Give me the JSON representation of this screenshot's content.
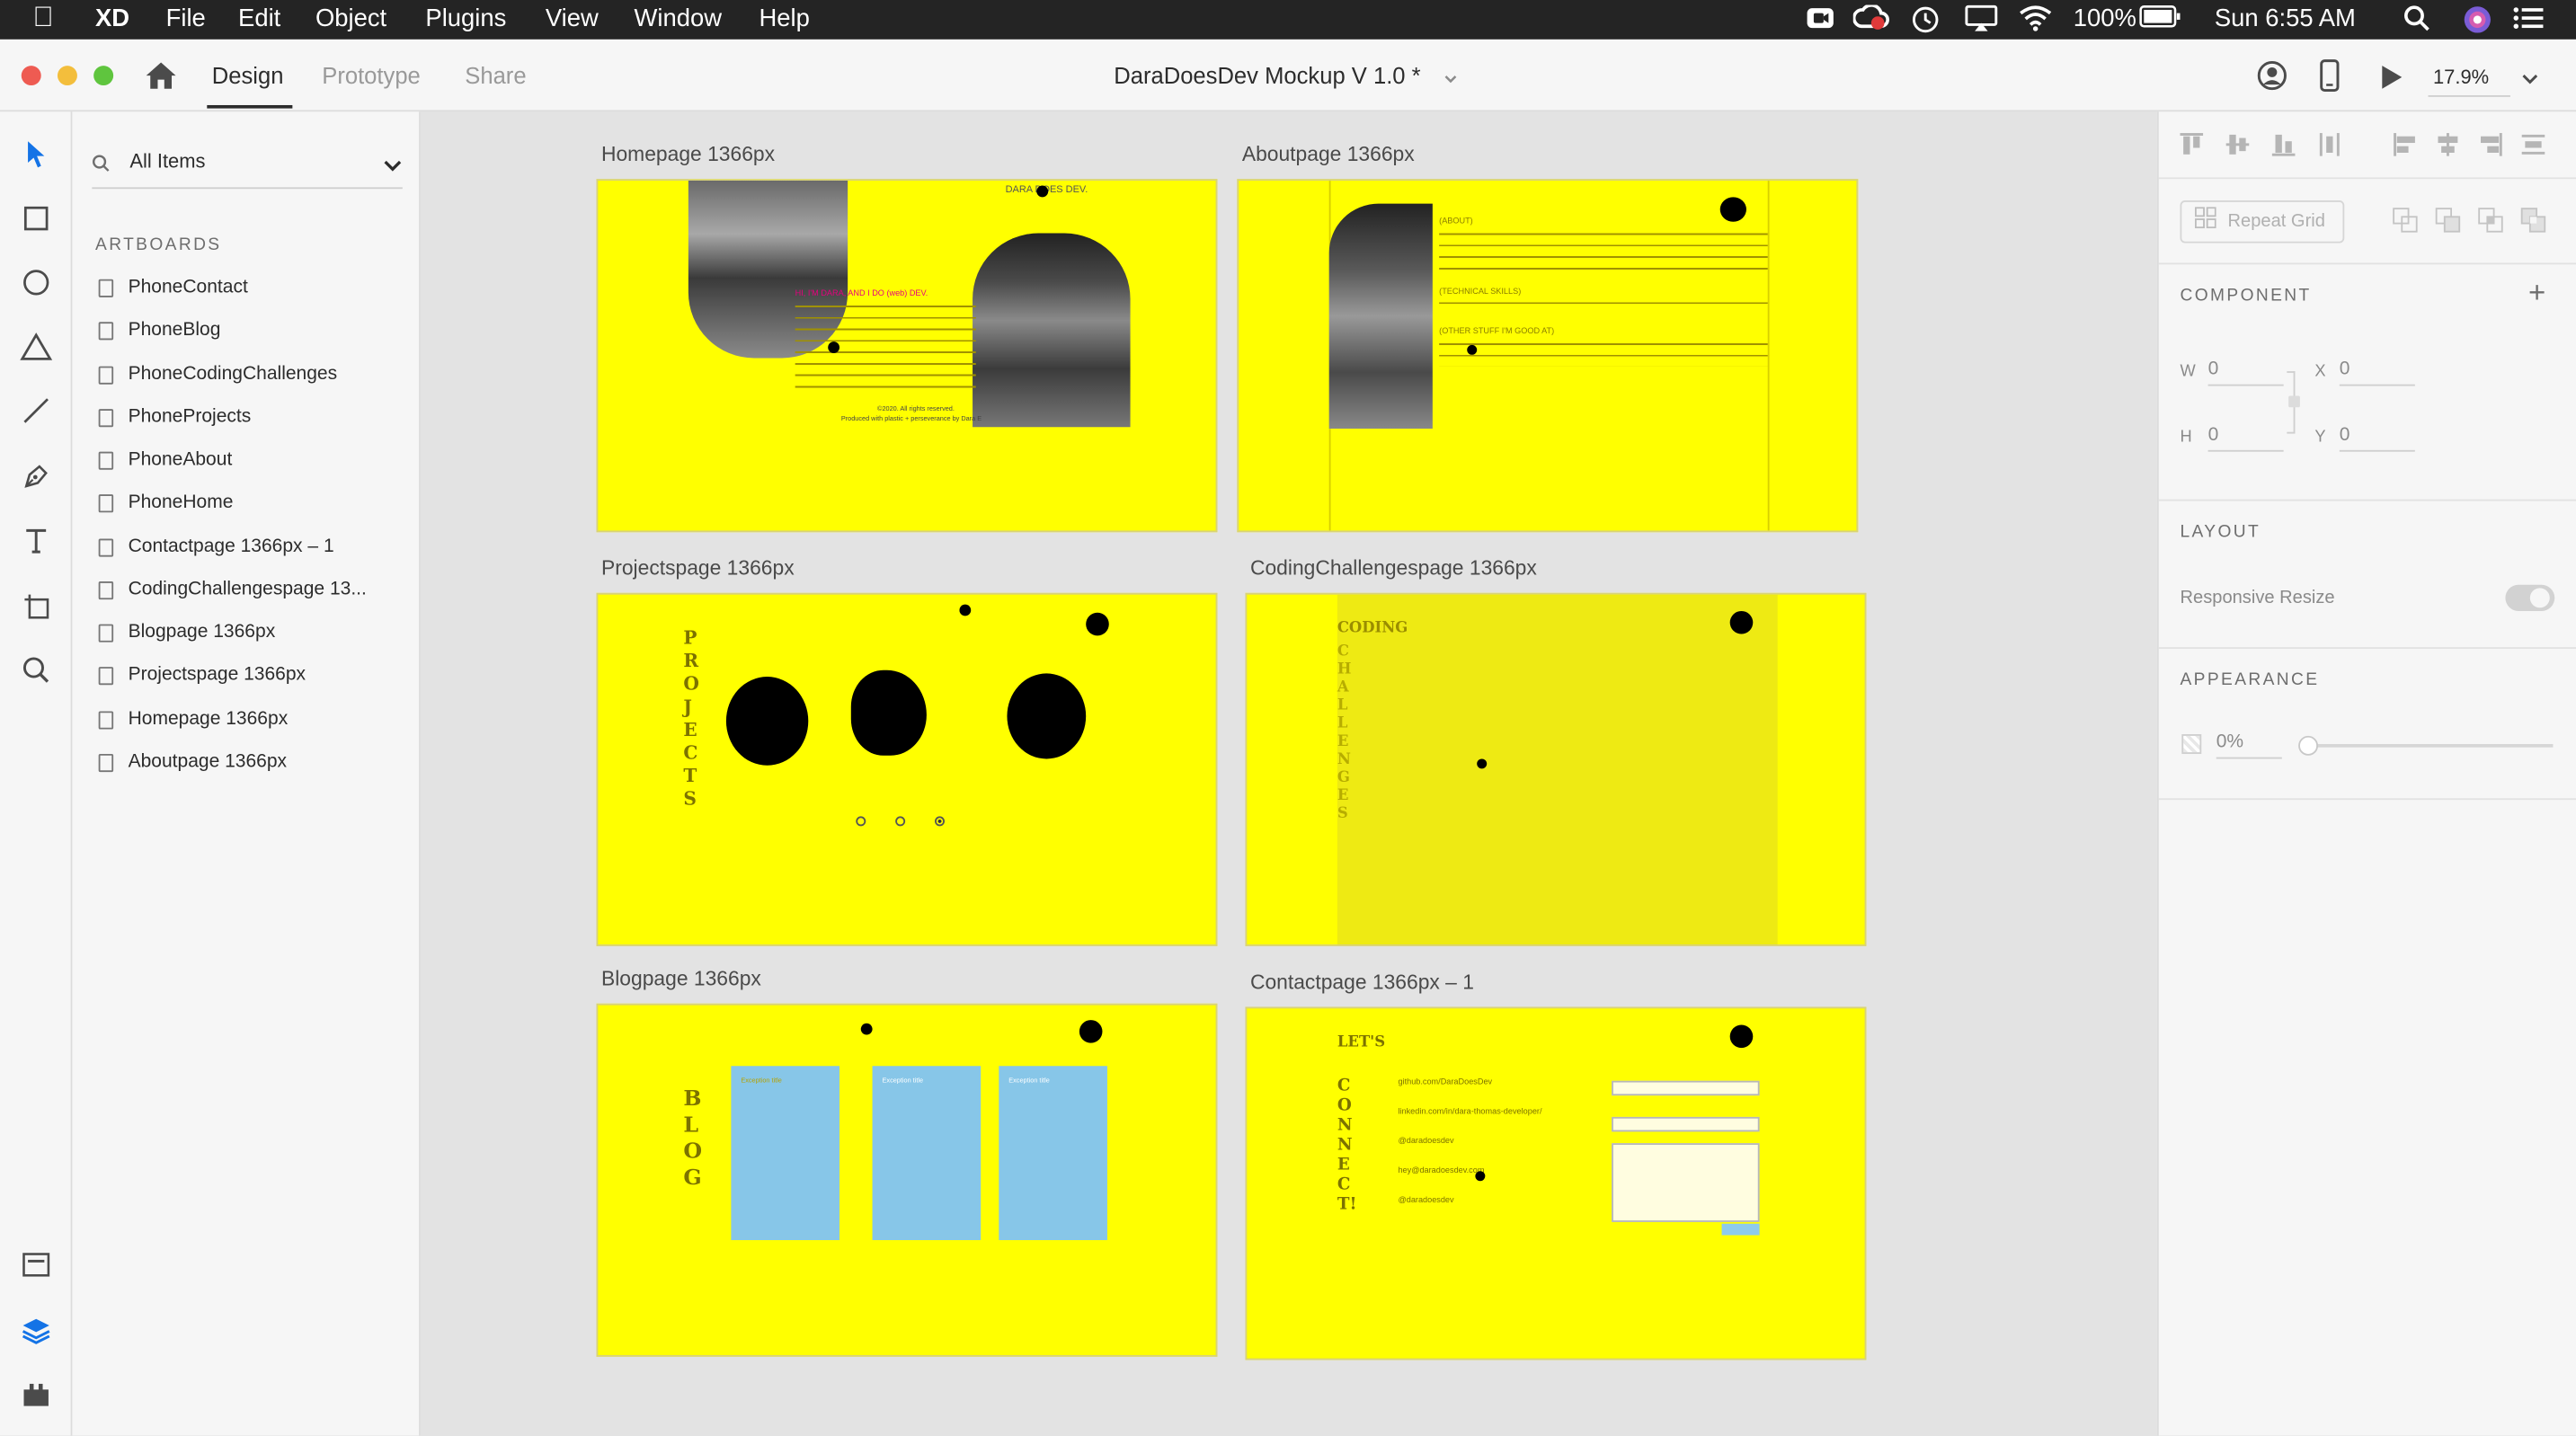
{
  "menubar": {
    "app": "XD",
    "items": [
      "File",
      "Edit",
      "Object",
      "Plugins",
      "View",
      "Window",
      "Help"
    ],
    "battery": "100%",
    "clock": "Sun 6:55 AM"
  },
  "titlebar": {
    "tabs": [
      "Design",
      "Prototype",
      "Share"
    ],
    "doc_title": "DaraDoesDev Mockup V 1.0 *",
    "zoom": "17.9%"
  },
  "layers": {
    "filter": "All Items",
    "section": "ARTBOARDS",
    "items": [
      "PhoneContact",
      "PhoneBlog",
      "PhoneCodingChallenges",
      "PhoneProjects",
      "PhoneAbout",
      "PhoneHome",
      "Contactpage 1366px – 1",
      "CodingChallengespage 13...",
      "Blogpage 1366px",
      "Projectspage 1366px",
      "Homepage 1366px",
      "Aboutpage 1366px"
    ]
  },
  "canvas": {
    "artboards": [
      {
        "name": "Homepage 1366px"
      },
      {
        "name": "Aboutpage 1366px"
      },
      {
        "name": "Projectspage 1366px"
      },
      {
        "name": "CodingChallengespage 1366px"
      },
      {
        "name": "Blogpage 1366px"
      },
      {
        "name": "Contactpage 1366px – 1"
      }
    ],
    "home_brand": "DARA DOES DEV.",
    "home_greeting": "HI, I'M DARA, AND I DO (web) DEV.",
    "home_footer1": "©2020. All rights reserved.",
    "home_footer2": "Produced with plastic + perseverance by Dara E",
    "about_h1": "(ABOUT)",
    "about_h2": "(TECHNICAL SKILLS)",
    "about_h3": "(OTHER STUFF I'M GOOD AT)",
    "projects_vert": "PROJECTS",
    "coding_top": "CODING",
    "coding_vert": "CHALLENGES",
    "blog_vert": "BLOG",
    "blog_card_title": "Exception title",
    "contact_top": "LET'S",
    "contact_vert": "CONNECT!",
    "contact_links": [
      "github.com/DaraDoesDev",
      "linkedin.com/in/dara-thomas-developer/",
      "@daradoesdev",
      "hey@daradoesdev.com",
      "@daradoesdev"
    ]
  },
  "props": {
    "repeat_grid": "Repeat Grid",
    "component": "COMPONENT",
    "w_label": "W",
    "w_val": "0",
    "x_label": "X",
    "x_val": "0",
    "h_label": "H",
    "h_val": "0",
    "y_label": "Y",
    "y_val": "0",
    "layout": "LAYOUT",
    "responsive": "Responsive Resize",
    "appearance": "APPEARANCE",
    "opacity": "0%"
  },
  "colors": {
    "artboard": "#ffff00",
    "accent": "#1473e6",
    "card": "#87c6e8"
  }
}
